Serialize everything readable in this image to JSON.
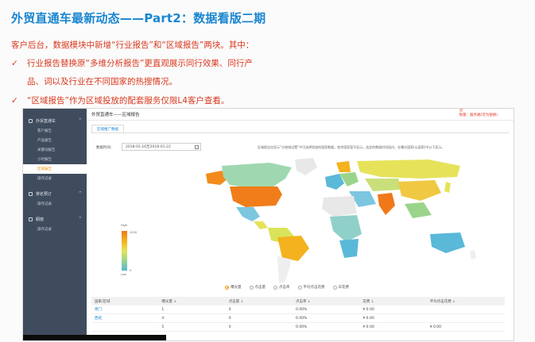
{
  "slide": {
    "title": "外贸直通车最新动态——Part2：数据看版二期",
    "intro": "客户后台，数据模块中新增“行业报告”和“区域报告”两块。其中：",
    "check": "✓",
    "bullet1_line1": "行业报告替换原“多维分析报告”更直观展示同行效果、同行产",
    "bullet1_line2": "品、词以及行业在不同国家的热搜情况。",
    "bullet2": "“区域报告”作为区域投放的配套服务仅限L4客户查看。"
  },
  "sidebar": {
    "group1": "外贸直通车",
    "items": [
      "客户报告",
      "产品报告",
      "关键词报告",
      "小时报告",
      "区域报告",
      "操作记录"
    ],
    "active_index": 4,
    "group2": "排名预订",
    "group2_items": [
      "操作记录"
    ],
    "group3": "橱窗",
    "group3_items": [
      "操作记录"
    ]
  },
  "header": {
    "breadcrumb": "外贸直通车——区域报告",
    "corner_note_line1": "注：",
    "corner_note_line2": "限量：服务端(可为替换)"
  },
  "tabs": [
    "区域推广数据"
  ],
  "filter": {
    "date_label": "数据时间：",
    "date_value": "2018-01-16至2018-01-22"
  },
  "map_note": "区域报告仅显示“分地域设置”中可选择投放的国家数据，其余国家暂不显示。选定的数据时间段内，在曝光国家(以国家)中以下显示。",
  "legend": {
    "high": "High",
    "low": "Low",
    "max": "1016",
    "min": "0"
  },
  "metrics": {
    "options": [
      "曝光量",
      "点击量",
      "点击率",
      "平均点击花费",
      "日花费"
    ],
    "selected": 0
  },
  "table": {
    "headers": [
      "国家/区域",
      "曝光量 ↓",
      "点击量 ↓",
      "点击率 ↓",
      "花费 ↓",
      "平均点击花费 ↓"
    ],
    "rows": [
      [
        "德门",
        "1",
        "0",
        "0.00%",
        "¥ 0.00",
        ""
      ],
      [
        "西班",
        "4",
        "0",
        "0.00%",
        "¥ 0.00",
        ""
      ],
      [
        "",
        "5",
        "0",
        "0.00%",
        "¥ 0.00",
        "¥ 0.00"
      ]
    ]
  },
  "colors": {
    "title_blue": "#1a86d0",
    "text_red": "#d9381e",
    "sidebar_bg": "#3f4c5e",
    "accent_orange": "#f29000"
  }
}
